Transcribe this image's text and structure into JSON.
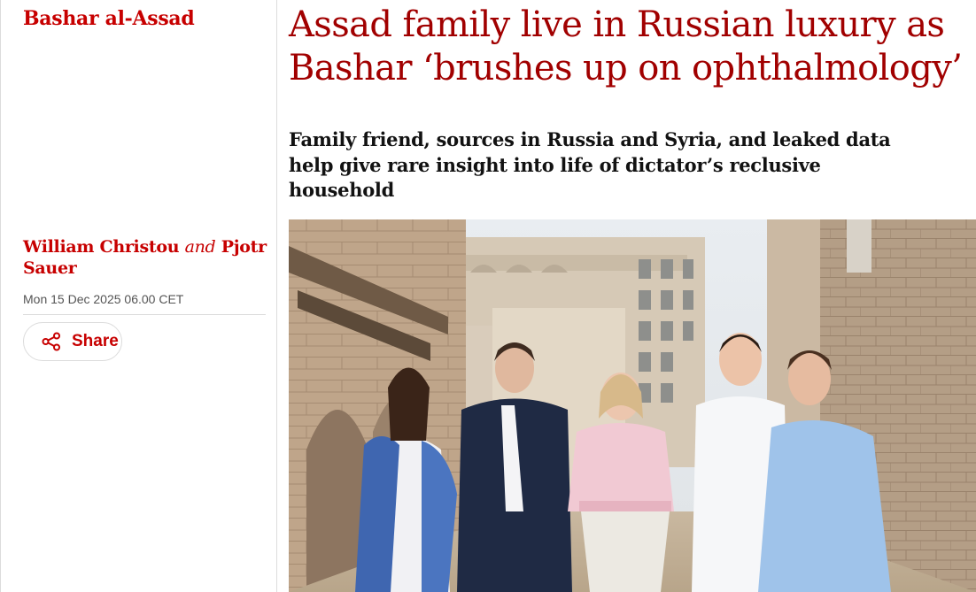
{
  "section": {
    "tag": "Bashar al-Assad"
  },
  "article": {
    "headline": "Assad family live in Russian luxury as Bashar ‘brushes up on ophthalmology’",
    "standfirst": "Family friend, sources in Russia and Syria, and leaked data help give rare insight into life of dictator’s reclusive household",
    "bylines": {
      "author1": "William Christou",
      "conjunction": "and",
      "author2": "Pjotr Sauer"
    },
    "date": "Mon 15 Dec 2025 06.00 CET",
    "share": {
      "label": "Share",
      "icon": "share-icon"
    }
  },
  "colors": {
    "section_red": "#c70000",
    "headline_red": "#a10000",
    "text": "#121212",
    "muted": "#545454"
  }
}
